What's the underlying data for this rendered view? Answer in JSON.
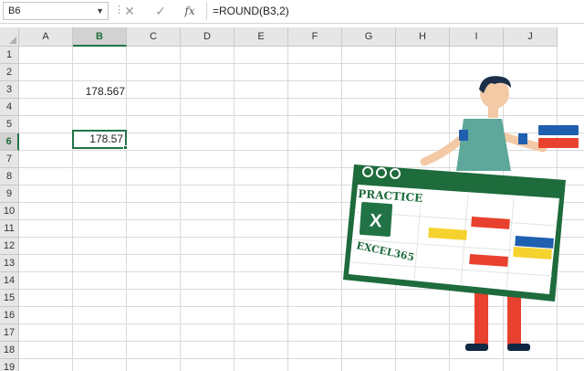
{
  "formula_bar": {
    "name_box": "B6",
    "name_box_arrow": "▼",
    "separator": "⋮",
    "cancel_glyph": "✕",
    "enter_glyph": "✓",
    "fx_label": "fx",
    "formula": "=ROUND(B3,2)"
  },
  "grid": {
    "columns": [
      "A",
      "B",
      "C",
      "D",
      "E",
      "F",
      "G",
      "H",
      "I",
      "J"
    ],
    "rows": [
      "1",
      "2",
      "3",
      "4",
      "5",
      "6",
      "7",
      "8",
      "9",
      "10",
      "11",
      "12",
      "13",
      "14",
      "15",
      "16",
      "17",
      "18",
      "19"
    ],
    "selected_column": "B",
    "selected_row": "6",
    "cells": {
      "B3": "178.567",
      "B6": "178.57"
    }
  },
  "illustration": {
    "practice_text": "PRACTICE",
    "excel_text": "EXCEL365",
    "logo_letter": "X",
    "colors": {
      "excel_green": "#217346",
      "board_green": "#1e6b3c",
      "red": "#e8412f",
      "blue": "#1f5fb0",
      "yellow": "#f5d22e",
      "shirt": "#5da89a",
      "pants": "#e8412f"
    }
  }
}
